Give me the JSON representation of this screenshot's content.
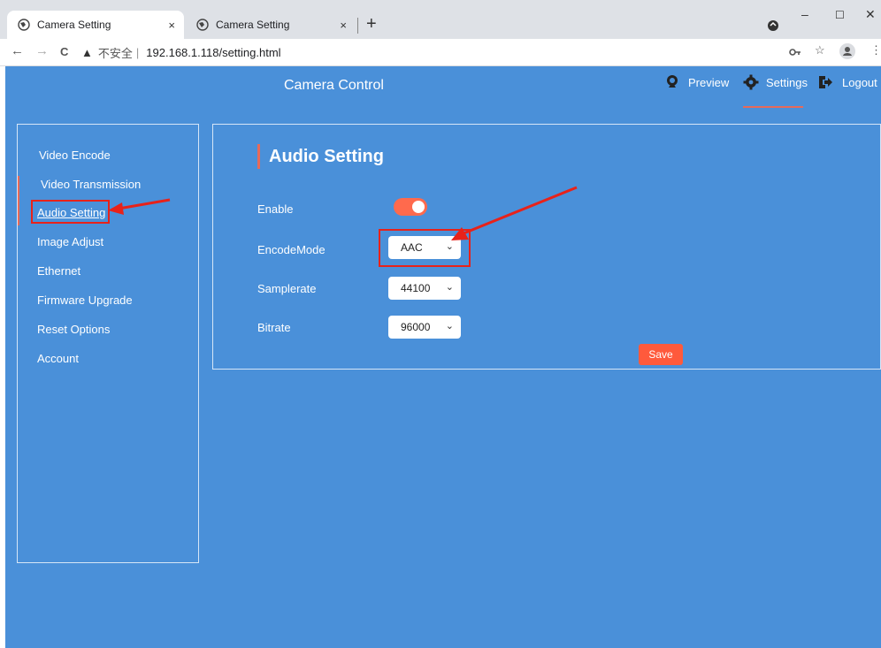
{
  "browser": {
    "tabs": [
      {
        "label": "Camera Setting",
        "close": "×"
      },
      {
        "label": "Camera Setting",
        "close": "×"
      }
    ],
    "new_tab": "+",
    "window_controls": {
      "minimize": "–",
      "maximize": "☐",
      "close": "✕"
    },
    "nav": {
      "back": "←",
      "forward": "→",
      "reload": "C"
    },
    "address": {
      "warning_icon": "▲",
      "insecure_label": "不安全",
      "separator": "|",
      "url": "192.168.1.118/setting.html"
    }
  },
  "app": {
    "title": "Camera Control",
    "nav": {
      "preview": "Preview",
      "settings": "Settings",
      "logout": "Logout"
    },
    "accent_color": "#e66a5a",
    "background_color": "#4a90d9"
  },
  "sidebar": {
    "items": [
      {
        "label": "Video Encode"
      },
      {
        "label": "Video Transmission"
      },
      {
        "label": "Audio Setting",
        "selected": true
      },
      {
        "label": "Image Adjust"
      },
      {
        "label": "Ethernet"
      },
      {
        "label": "Firmware Upgrade"
      },
      {
        "label": "Reset Options"
      },
      {
        "label": "Account"
      }
    ]
  },
  "panel": {
    "title": "Audio Setting",
    "fields": {
      "enable": {
        "label": "Enable",
        "on": true
      },
      "encode_mode": {
        "label": "EncodeMode",
        "value": "AAC"
      },
      "samplerate": {
        "label": "Samplerate",
        "value": "44100"
      },
      "bitrate": {
        "label": "Bitrate",
        "value": "96000"
      }
    },
    "save_label": "Save"
  }
}
